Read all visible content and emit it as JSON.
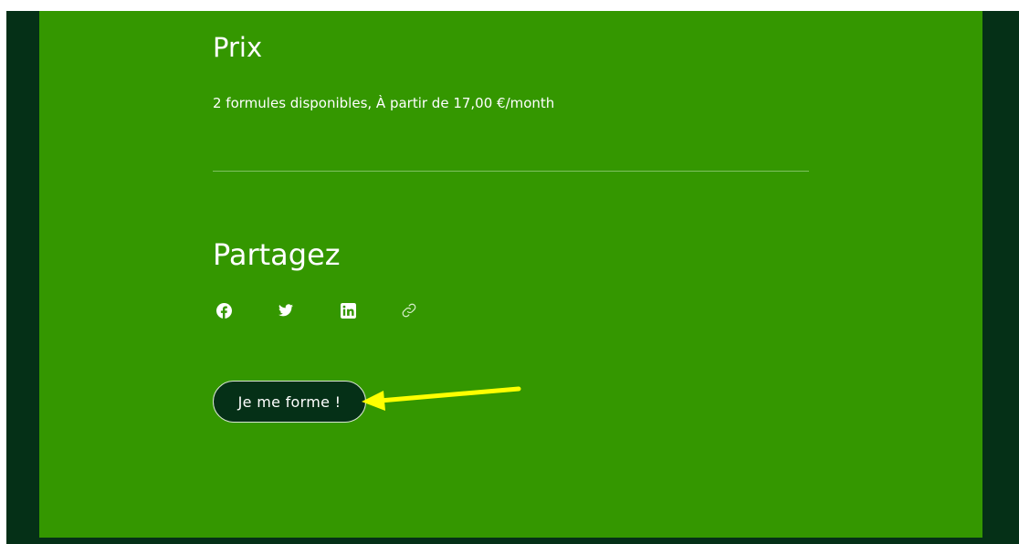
{
  "pricing": {
    "heading": "Prix",
    "summary": "2 formules disponibles, À partir de 17,00 €/month"
  },
  "share": {
    "heading": "Partagez",
    "icons": [
      "facebook-icon",
      "twitter-icon",
      "linkedin-icon",
      "link-icon"
    ]
  },
  "cta": {
    "label": "Je me forme !"
  },
  "annotation": {
    "type": "arrow",
    "color": "#ffff00",
    "points_to": "cta-button"
  },
  "colors": {
    "panel_background": "#349700",
    "frame_background": "#053017",
    "button_background": "#053017",
    "text": "#ffffff"
  }
}
